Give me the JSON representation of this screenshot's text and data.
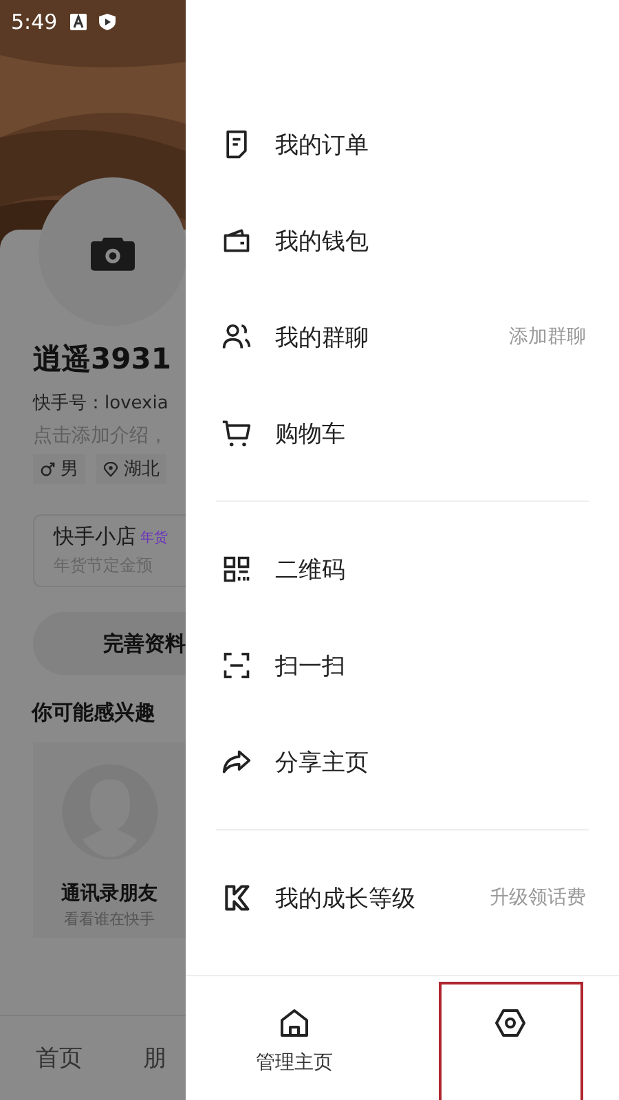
{
  "status_bar": {
    "time": "5:49"
  },
  "profile": {
    "name": "逍遥3931",
    "account": "快手号：lovexia",
    "intro": "点击添加介绍，",
    "tags": [
      {
        "kind": "gender",
        "label": "男"
      },
      {
        "kind": "location",
        "label": "湖北"
      }
    ],
    "shop": {
      "title": "快手小店",
      "badge": "年货",
      "subtitle": "年货节定金预"
    },
    "complete_button": "完善资料",
    "suggest_title": "你可能感兴趣",
    "suggest_card": {
      "title": "通讯录朋友",
      "subtitle": "看看谁在快手"
    }
  },
  "bottom_tabs": [
    "首页",
    "朋"
  ],
  "drawer": {
    "sections": [
      [
        {
          "kind": "order",
          "label": "我的订单"
        },
        {
          "kind": "wallet",
          "label": "我的钱包"
        },
        {
          "kind": "group",
          "label": "我的群聊",
          "hint": "添加群聊"
        },
        {
          "kind": "cart",
          "label": "购物车"
        }
      ],
      [
        {
          "kind": "qrcode",
          "label": "二维码"
        },
        {
          "kind": "scan",
          "label": "扫一扫"
        },
        {
          "kind": "share",
          "label": "分享主页"
        }
      ],
      [
        {
          "kind": "level",
          "label": "我的成长等级",
          "hint": "升级领话费"
        }
      ]
    ],
    "footer": [
      {
        "kind": "home",
        "label": "管理主页",
        "highlighted": false
      },
      {
        "kind": "settings",
        "highlighted": true
      }
    ]
  }
}
